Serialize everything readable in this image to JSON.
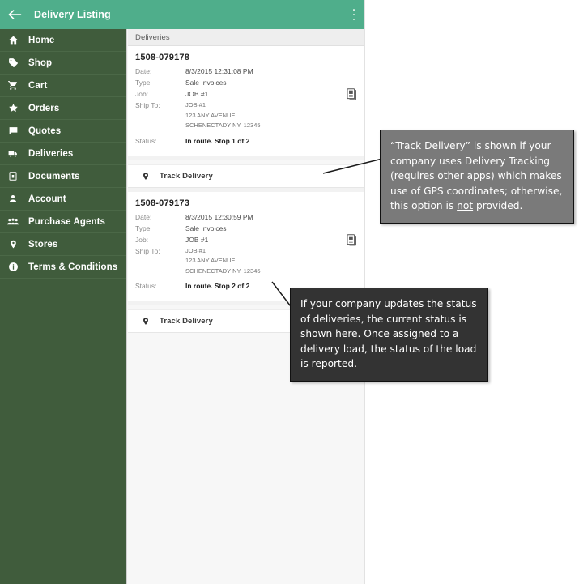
{
  "topbar": {
    "title": "Delivery Listing",
    "back_icon": "arrow-left-icon",
    "overflow_icon": "overflow-menu-icon"
  },
  "sidebar": {
    "items": [
      {
        "label": "Home",
        "icon": "home-icon"
      },
      {
        "label": "Shop",
        "icon": "tag-icon"
      },
      {
        "label": "Cart",
        "icon": "shopping-cart-icon"
      },
      {
        "label": "Orders",
        "icon": "star-icon"
      },
      {
        "label": "Quotes",
        "icon": "chat-bubble-icon"
      },
      {
        "label": "Deliveries",
        "icon": "truck-icon"
      },
      {
        "label": "Documents",
        "icon": "document-icon"
      },
      {
        "label": "Account",
        "icon": "person-icon"
      },
      {
        "label": "Purchase Agents",
        "icon": "people-icon"
      },
      {
        "label": "Stores",
        "icon": "map-pin-icon"
      },
      {
        "label": "Terms & Conditions",
        "icon": "info-icon"
      }
    ]
  },
  "content": {
    "section_title": "Deliveries",
    "field_labels": {
      "date": "Date:",
      "type": "Type:",
      "job": "Job:",
      "ship_to": "Ship To:",
      "status": "Status:"
    },
    "track_label": "Track Delivery",
    "deliveries": [
      {
        "id": "1508-079178",
        "date": "8/3/2015 12:31:08 PM",
        "type": "Sale Invoices",
        "job": "JOB #1",
        "ship_to_name": "JOB #1",
        "ship_to_street": "123 ANY AVENUE",
        "ship_to_citystate": "SCHENECTADY NY, 12345",
        "status": "In route. Stop 1 of 2",
        "doc_icon": "document-icon"
      },
      {
        "id": "1508-079173",
        "date": "8/3/2015 12:30:59 PM",
        "type": "Sale Invoices",
        "job": "JOB #1",
        "ship_to_name": "JOB #1",
        "ship_to_street": "123 ANY AVENUE",
        "ship_to_citystate": "SCHENECTADY NY, 12345",
        "status": "In route. Stop 2 of 2",
        "doc_icon": "document-icon"
      }
    ]
  },
  "callouts": {
    "track": {
      "part1": "“Track Delivery” is shown if your company uses Delivery Tracking (requires other apps) which makes use of GPS coordinates; otherwise, this option is ",
      "emphasis": "not",
      "part2": " provided."
    },
    "status": {
      "text": "If your company updates the status of deliveries, the current status is shown here. Once assigned to a delivery load, the status of the load is reported."
    }
  },
  "colors": {
    "topbar_green": "#4fae8b",
    "sidebar_green": "#405c3c",
    "page_bg": "#f7f7f7",
    "callout_gray": "#7a7a7a",
    "callout_dark": "#333333"
  }
}
